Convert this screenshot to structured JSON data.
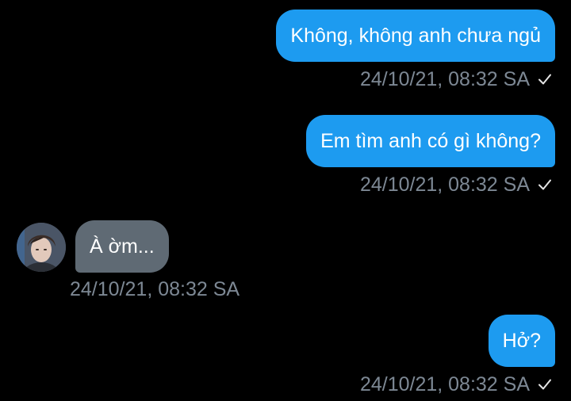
{
  "messages": [
    {
      "direction": "sent",
      "text": "Không, không anh chưa ngủ",
      "time": "24/10/21, 08:32 SA"
    },
    {
      "direction": "sent",
      "text": "Em tìm anh có gì không?",
      "time": "24/10/21, 08:32 SA"
    },
    {
      "direction": "received",
      "text": "À ờm...",
      "time": "24/10/21, 08:32 SA"
    },
    {
      "direction": "sent",
      "text": "Hở?",
      "time": "24/10/21, 08:32 SA"
    }
  ],
  "colors": {
    "sent_bubble": "#1d9bf0",
    "received_bubble": "#5f6a74",
    "timestamp": "#7d8894",
    "background": "#000000"
  },
  "icons": {
    "read_receipt": "checkmark-icon",
    "avatar": "user-avatar"
  }
}
